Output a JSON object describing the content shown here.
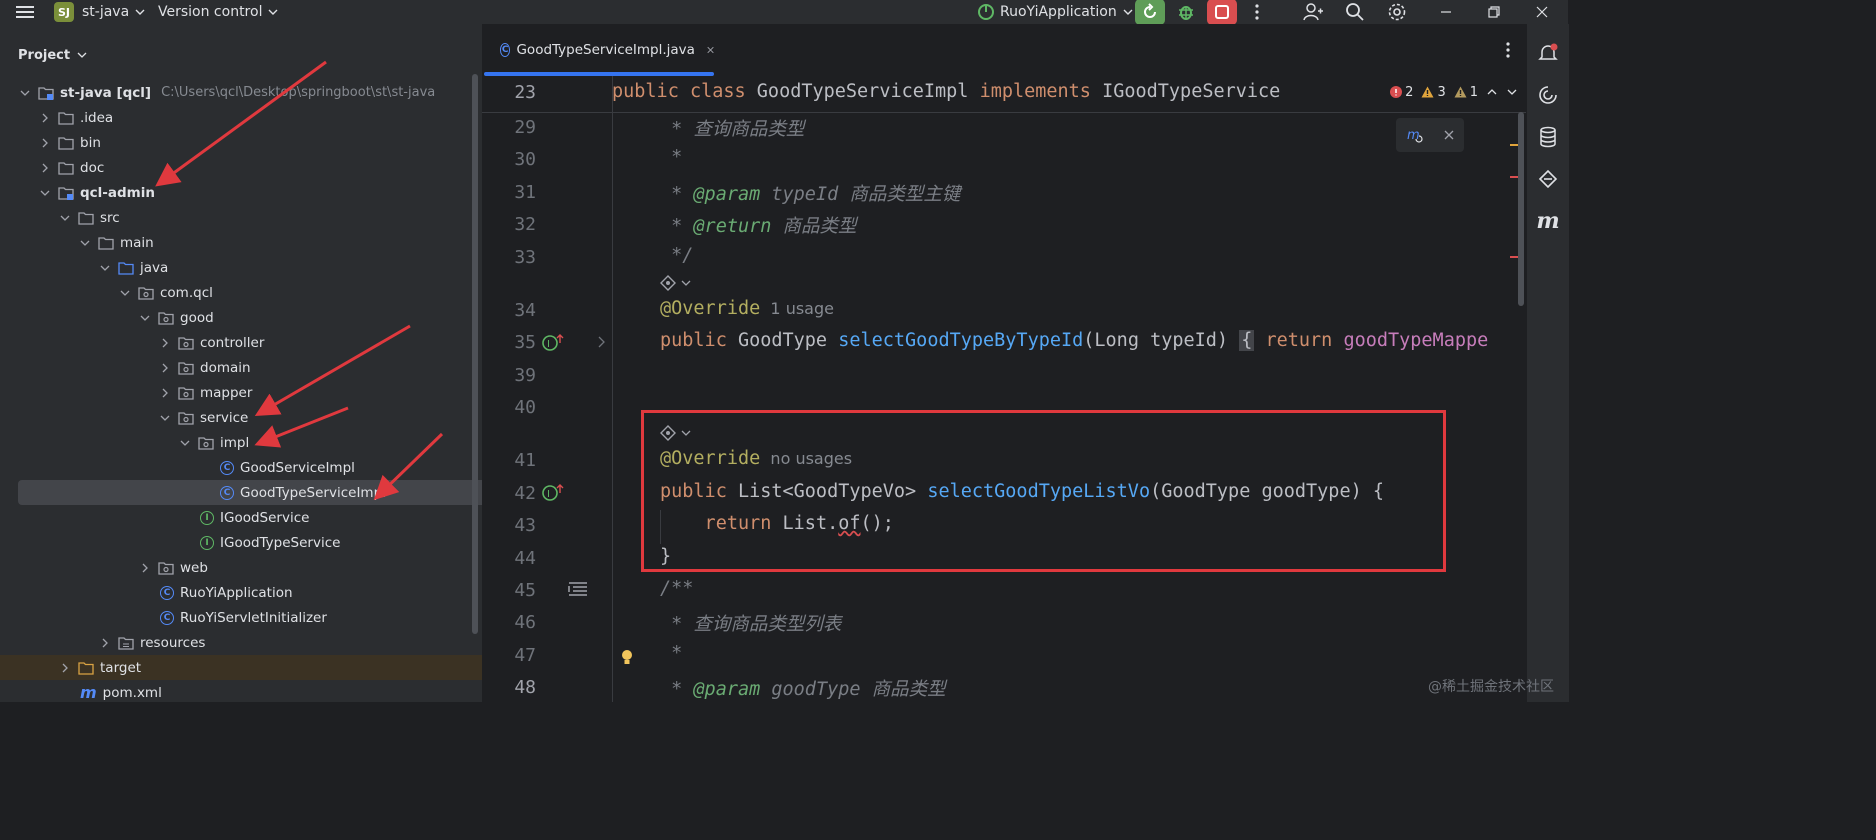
{
  "titlebar": {
    "project_badge": "SJ",
    "project_name": "st-java",
    "vcs_menu": "Version control",
    "run_config": "RuoYiApplication",
    "colors": {
      "run": "#5f9d58",
      "stop": "#d94e50"
    }
  },
  "project_panel": {
    "title": "Project",
    "tree": [
      {
        "label": "st-java [qcl]",
        "path": "C:\\Users\\qcl\\Desktop\\springboot\\st\\st-java",
        "kind": "module",
        "expanded": true
      },
      {
        "label": ".idea",
        "kind": "folder",
        "expanded": false
      },
      {
        "label": "bin",
        "kind": "folder",
        "expanded": false
      },
      {
        "label": "doc",
        "kind": "folder",
        "expanded": false
      },
      {
        "label": "qcl-admin",
        "kind": "module",
        "expanded": true
      },
      {
        "label": "src",
        "kind": "folder",
        "expanded": true
      },
      {
        "label": "main",
        "kind": "folder",
        "expanded": true
      },
      {
        "label": "java",
        "kind": "source-folder",
        "expanded": true
      },
      {
        "label": "com.qcl",
        "kind": "package",
        "expanded": true
      },
      {
        "label": "good",
        "kind": "package",
        "expanded": true
      },
      {
        "label": "controller",
        "kind": "package",
        "expanded": false
      },
      {
        "label": "domain",
        "kind": "package",
        "expanded": false
      },
      {
        "label": "mapper",
        "kind": "package",
        "expanded": false
      },
      {
        "label": "service",
        "kind": "package",
        "expanded": true
      },
      {
        "label": "impl",
        "kind": "package",
        "expanded": true
      },
      {
        "label": "GoodServiceImpl",
        "kind": "class"
      },
      {
        "label": "GoodTypeServiceImpl",
        "kind": "class",
        "selected": true
      },
      {
        "label": "IGoodService",
        "kind": "interface"
      },
      {
        "label": "IGoodTypeService",
        "kind": "interface"
      },
      {
        "label": "web",
        "kind": "package",
        "expanded": false
      },
      {
        "label": "RuoYiApplication",
        "kind": "class"
      },
      {
        "label": "RuoYiServletInitializer",
        "kind": "class"
      },
      {
        "label": "resources",
        "kind": "resources",
        "expanded": false
      },
      {
        "label": "target",
        "kind": "excluded",
        "expanded": false
      },
      {
        "label": "pom.xml",
        "kind": "maven"
      }
    ]
  },
  "editor": {
    "tab_label": "GoodTypeServiceImpl.java",
    "sticky_line": {
      "num": "23",
      "tokens": [
        {
          "t": "public ",
          "c": "kw"
        },
        {
          "t": "class ",
          "c": "kw"
        },
        {
          "t": "GoodTypeServiceImpl ",
          "c": "cls"
        },
        {
          "t": "implements ",
          "c": "kw"
        },
        {
          "t": "IGoodTypeService",
          "c": "cls"
        }
      ]
    },
    "problems": {
      "errors": "2",
      "warnings": "3",
      "weak_warnings": "1"
    },
    "lines": [
      {
        "num": "29",
        "tokens": [
          {
            "t": " * ",
            "c": "cm"
          },
          {
            "t": "查询商品类型",
            "c": "cm"
          }
        ]
      },
      {
        "num": "30",
        "tokens": [
          {
            "t": " *",
            "c": "cm"
          }
        ]
      },
      {
        "num": "31",
        "tokens": [
          {
            "t": " * ",
            "c": "cm"
          },
          {
            "t": "@param",
            "c": "tag"
          },
          {
            "t": " typeId ",
            "c": "cm"
          },
          {
            "t": "商品类型主键",
            "c": "cm"
          }
        ]
      },
      {
        "num": "32",
        "tokens": [
          {
            "t": " * ",
            "c": "cm"
          },
          {
            "t": "@return",
            "c": "tag"
          },
          {
            "t": " 商品类型",
            "c": "cm"
          }
        ]
      },
      {
        "num": "33",
        "tokens": [
          {
            "t": " */",
            "c": "cm"
          }
        ]
      },
      {
        "num": "34",
        "tokens": [
          {
            "t": "@Override",
            "c": "ann"
          },
          {
            "t": "  1 usage",
            "c": "hint"
          }
        ]
      },
      {
        "num": "35",
        "tokens": [
          {
            "t": "public ",
            "c": "kw"
          },
          {
            "t": "GoodType ",
            "c": "cls"
          },
          {
            "t": "selectGoodTypeByTypeId",
            "c": "fn"
          },
          {
            "t": "(Long typeId) ",
            "c": "cls"
          },
          {
            "t": "{",
            "c": "brace"
          },
          {
            "t": " return ",
            "c": "kw"
          },
          {
            "t": "goodTypeMappe",
            "c": "fld"
          }
        ]
      },
      {
        "num": "39",
        "tokens": []
      },
      {
        "num": "40",
        "tokens": []
      },
      {
        "num": "41",
        "tokens": [
          {
            "t": "@Override",
            "c": "ann"
          },
          {
            "t": "  no usages",
            "c": "hint"
          }
        ]
      },
      {
        "num": "42",
        "tokens": [
          {
            "t": "public ",
            "c": "kw"
          },
          {
            "t": "List<GoodTypeVo> ",
            "c": "cls"
          },
          {
            "t": "selectGoodTypeListVo",
            "c": "fn"
          },
          {
            "t": "(GoodType goodType) {",
            "c": "cls"
          }
        ]
      },
      {
        "num": "43",
        "tokens": [
          {
            "t": "    return ",
            "c": "kw"
          },
          {
            "t": "List.",
            "c": "cls"
          },
          {
            "t": "of",
            "c": "wavy"
          },
          {
            "t": "();",
            "c": "cls"
          }
        ]
      },
      {
        "num": "44",
        "tokens": [
          {
            "t": "}",
            "c": "cls"
          }
        ]
      },
      {
        "num": "45",
        "tokens": [
          {
            "t": "/**",
            "c": "cm"
          }
        ]
      },
      {
        "num": "46",
        "tokens": [
          {
            "t": " * ",
            "c": "cm"
          },
          {
            "t": "查询商品类型列表",
            "c": "cm"
          }
        ]
      },
      {
        "num": "47",
        "tokens": [
          {
            "t": " *",
            "c": "cm"
          }
        ]
      },
      {
        "num": "48",
        "tokens": [
          {
            "t": " * ",
            "c": "cm"
          },
          {
            "t": "@param",
            "c": "tag"
          },
          {
            "t": " goodType ",
            "c": "cm"
          },
          {
            "t": "商品类型",
            "c": "cm"
          }
        ]
      }
    ]
  },
  "watermark": "@稀土掘金技术社区",
  "annotation_color": "#e0393e"
}
